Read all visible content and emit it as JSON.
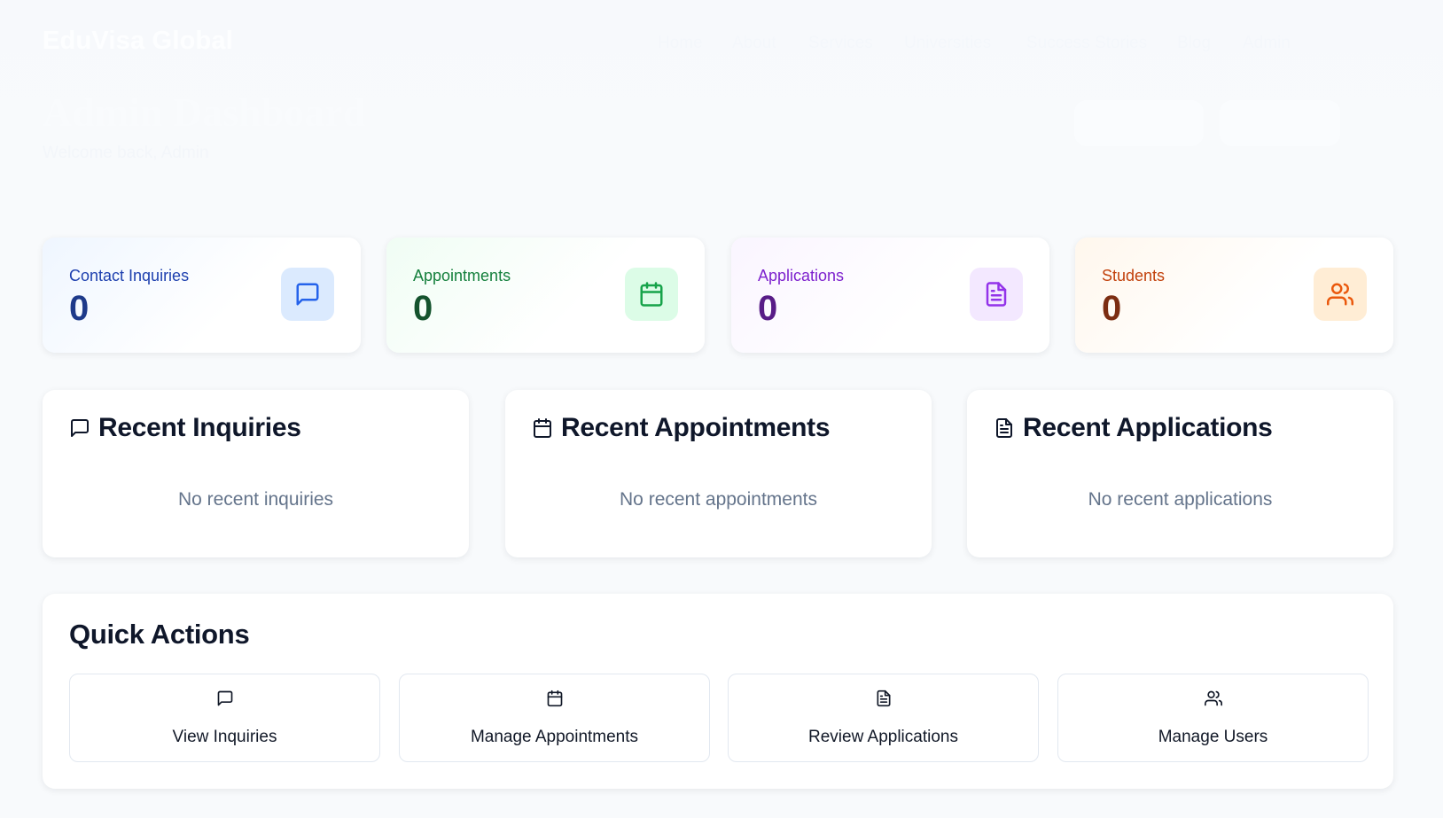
{
  "header": {
    "brand": "EduVisa Global",
    "nav": [
      "Home",
      "About",
      "Services",
      "Universities",
      "Success Stories",
      "Blog",
      "Admin"
    ],
    "title": "Admin Dashboard",
    "welcome": "Welcome back, Admin"
  },
  "stats": [
    {
      "label": "Contact Inquiries",
      "value": "0",
      "icon": "message-square-icon",
      "color": "#1e40af",
      "bg": "#dbeafe"
    },
    {
      "label": "Appointments",
      "value": "0",
      "icon": "calendar-icon",
      "color": "#15803d",
      "bg": "#dcfce7"
    },
    {
      "label": "Applications",
      "value": "0",
      "icon": "file-text-icon",
      "color": "#7e22ce",
      "bg": "#f3e8ff"
    },
    {
      "label": "Students",
      "value": "0",
      "icon": "users-icon",
      "color": "#c2410c",
      "bg": "#ffedd5"
    }
  ],
  "panels": [
    {
      "title": "Recent Inquiries",
      "empty": "No recent inquiries",
      "icon": "message-square-icon"
    },
    {
      "title": "Recent Appointments",
      "empty": "No recent appointments",
      "icon": "calendar-icon"
    },
    {
      "title": "Recent Applications",
      "empty": "No recent applications",
      "icon": "file-text-icon"
    }
  ],
  "quick_actions": {
    "title": "Quick Actions",
    "actions": [
      {
        "label": "View Inquiries",
        "icon": "message-square-icon"
      },
      {
        "label": "Manage Appointments",
        "icon": "calendar-icon"
      },
      {
        "label": "Review Applications",
        "icon": "file-text-icon"
      },
      {
        "label": "Manage Users",
        "icon": "users-icon"
      }
    ]
  }
}
